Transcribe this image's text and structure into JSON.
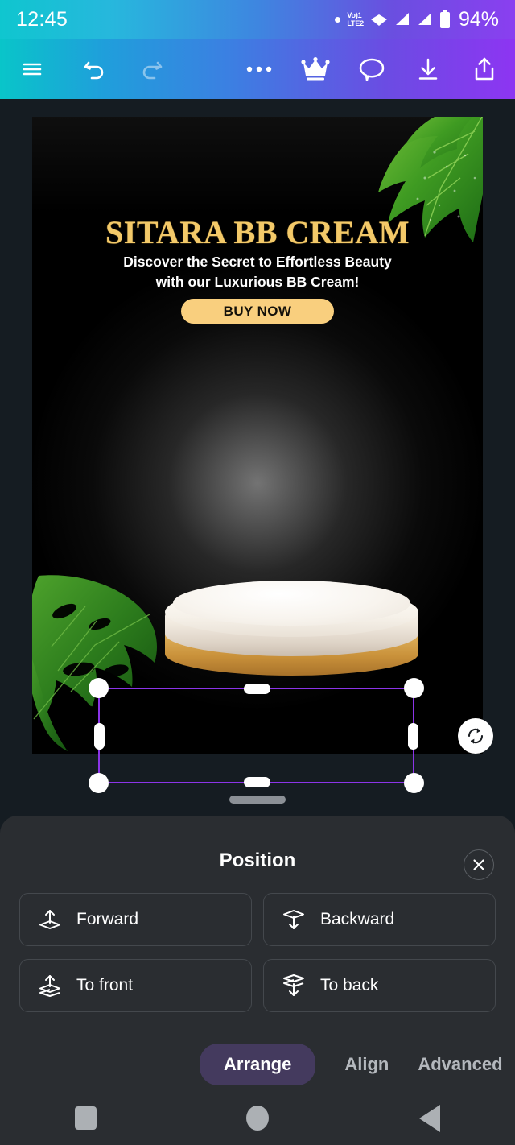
{
  "status_bar": {
    "time": "12:45",
    "network_label_top": "Vo)1",
    "network_label_bottom": "LTE2",
    "battery_percent": "94%",
    "icons": [
      "recording-dot-icon",
      "volte-icon",
      "wifi-icon",
      "signal-sim1-icon",
      "signal-sim2-icon",
      "battery-icon"
    ],
    "gradient_start": "#0fc6cf",
    "gradient_end": "#8a3ff0"
  },
  "toolbar": {
    "items": [
      {
        "name": "menu-icon",
        "label": "Menu"
      },
      {
        "name": "undo-icon",
        "label": "Undo"
      },
      {
        "name": "redo-icon",
        "label": "Redo"
      },
      {
        "name": "more-options-icon",
        "label": "More"
      },
      {
        "name": "crown-premium-icon",
        "label": "Premium"
      },
      {
        "name": "comment-icon",
        "label": "Comments"
      },
      {
        "name": "download-icon",
        "label": "Download"
      },
      {
        "name": "share-export-icon",
        "label": "Export"
      }
    ]
  },
  "canvas": {
    "design": {
      "title": "SITARA BB CREAM",
      "subtitle_line1": "Discover the Secret to Effortless Beauty",
      "subtitle_line2": "with our Luxurious BB Cream!",
      "cta_label": "BUY NOW",
      "title_color": "#f3c969",
      "cta_bg": "#f9cf7e",
      "background_color": "#000000"
    },
    "selection": {
      "border_color": "#8b34e8",
      "handle_color": "#ffffff",
      "rotate_icon": "rotate-icon"
    }
  },
  "sheet": {
    "title": "Position",
    "close_icon": "close-icon",
    "buttons": [
      {
        "label": "Forward",
        "icon": "bring-forward-icon"
      },
      {
        "label": "Backward",
        "icon": "send-backward-icon"
      },
      {
        "label": "To front",
        "icon": "bring-to-front-icon"
      },
      {
        "label": "To back",
        "icon": "send-to-back-icon"
      }
    ],
    "tabs": [
      {
        "label": "Arrange",
        "active": true
      },
      {
        "label": "Align",
        "active": false
      },
      {
        "label": "Advanced",
        "active": false
      }
    ],
    "active_tab_bg": "#443a5e",
    "background": "#2a2d31"
  },
  "nav_bar": {
    "items": [
      {
        "name": "recents-button",
        "icon": "square-icon"
      },
      {
        "name": "home-button",
        "icon": "circle-icon"
      },
      {
        "name": "back-button",
        "icon": "triangle-left-icon"
      }
    ]
  }
}
